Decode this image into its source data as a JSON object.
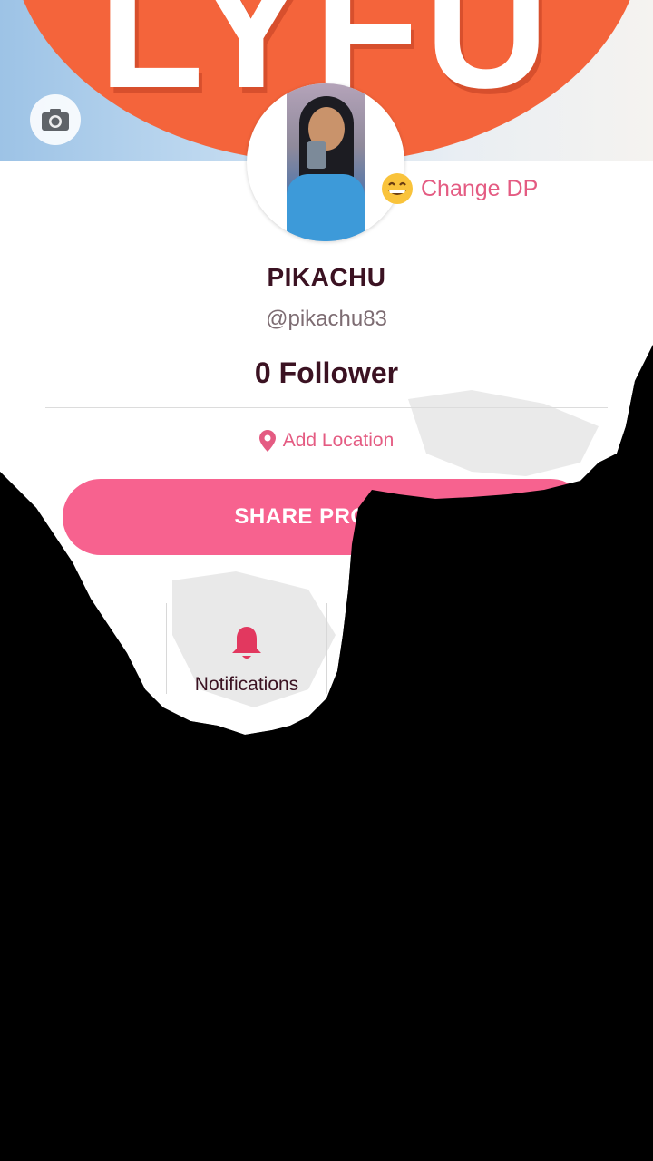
{
  "cover": {
    "logo_text": "LYFU",
    "camera_icon": "camera-icon"
  },
  "profile": {
    "change_dp_label": "Change DP",
    "change_dp_emoji": "grinning-face-emoji",
    "name": "PIKACHU",
    "username": "@pikachu83",
    "followers_text": "0 Follower",
    "location_label": "Add Location",
    "location_icon": "location-pin-icon"
  },
  "actions": {
    "share_label": "SHARE PROFILE"
  },
  "tabs": [
    {
      "label": "Notifications",
      "icon": "bell-icon"
    }
  ],
  "colors": {
    "accent_pink": "#f7628f",
    "link_pink": "#e45b82",
    "text_dark": "#3b1222",
    "cover_orange": "#f4643b"
  }
}
